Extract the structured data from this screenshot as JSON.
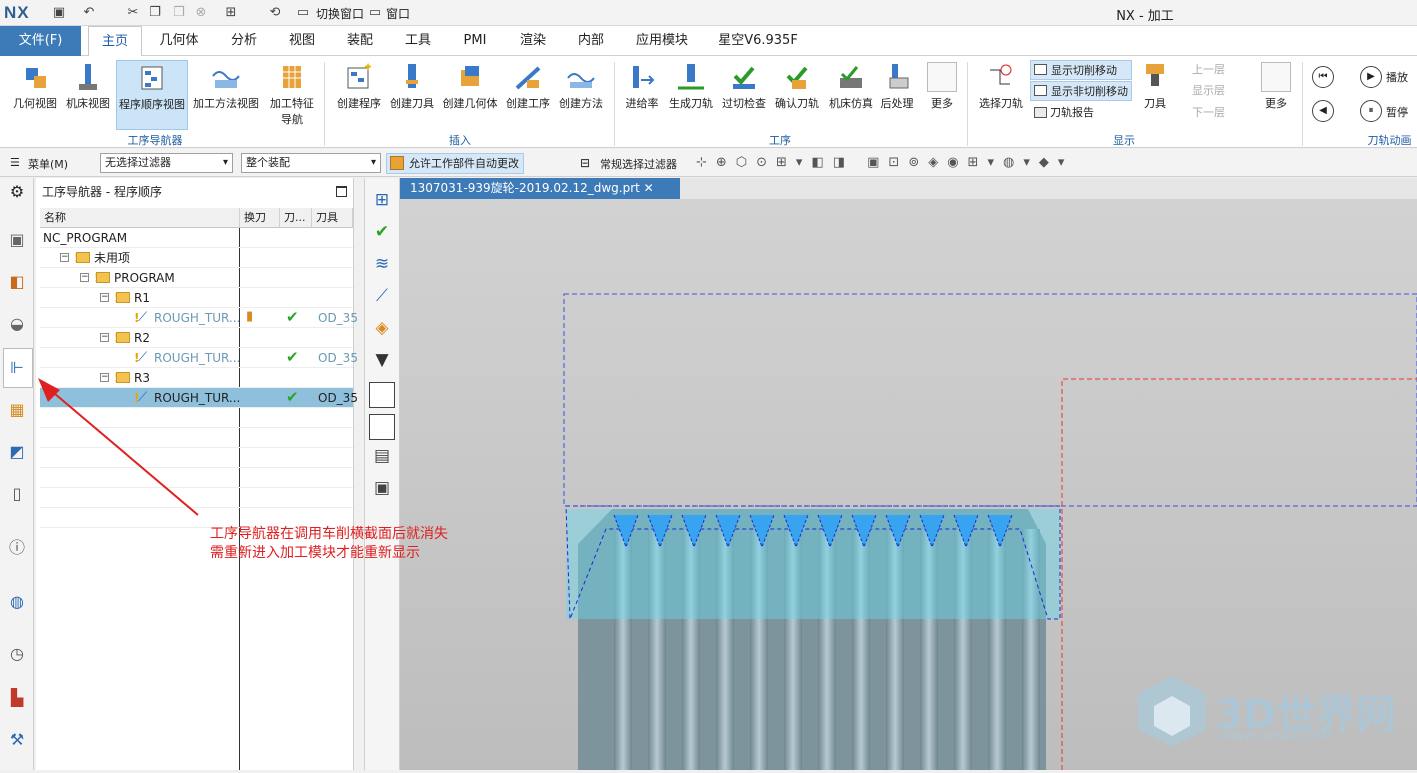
{
  "titlebar": {
    "logo": "NX",
    "switch_window": "切换窗口",
    "window": "窗口",
    "app_title": "NX - 加工"
  },
  "menu": {
    "file": "文件(F)",
    "tabs": [
      "主页",
      "几何体",
      "分析",
      "视图",
      "装配",
      "工具",
      "PMI",
      "渲染",
      "内部",
      "应用模块",
      "星空V6.935F"
    ]
  },
  "ribbon": {
    "nav_group": {
      "buttons": [
        "几何视图",
        "机床视图",
        "程序顺序视图",
        "加工方法视图",
        "加工特征导航"
      ],
      "label": "工序导航器"
    },
    "insert_group": {
      "buttons": [
        "创建程序",
        "创建刀具",
        "创建几何体",
        "创建工序",
        "创建方法"
      ],
      "label": "插入"
    },
    "operation_group": {
      "buttons": [
        "进给率",
        "生成刀轨",
        "过切检查",
        "确认刀轨",
        "机床仿真",
        "后处理",
        "更多"
      ],
      "label": "工序"
    },
    "display_group": {
      "select_tool": "选择刀轨",
      "show_cut": "显示切削移动",
      "show_noncut": "显示非切削移动",
      "toolpath_report": "刀轨报告",
      "tool": "刀具",
      "up": "上一层",
      "display": "显示层",
      "down": "下一层",
      "more": "更多",
      "label": "显示"
    },
    "anim_group": {
      "play": "播放",
      "pause": "暂停",
      "label": "刀轨动画"
    }
  },
  "toolbar2": {
    "menu": "菜单(M)",
    "filter": "无选择过滤器",
    "assembly": "整个装配",
    "allow": "允许工作部件自动更改",
    "general_filter": "常规选择过滤器"
  },
  "navigator": {
    "title": "工序导航器 - 程序顺序",
    "columns": [
      "名称",
      "换刀",
      "刀...",
      "刀具"
    ],
    "rows": [
      {
        "name": "NC_PROGRAM",
        "tool": "",
        "path": ""
      },
      {
        "name": "未用项",
        "tool": "",
        "path": ""
      },
      {
        "name": "PROGRAM",
        "tool": "",
        "path": ""
      },
      {
        "name": "R1",
        "tool": "",
        "path": ""
      },
      {
        "name": "ROUGH_TUR...",
        "tool": "OD_35",
        "path": "✔"
      },
      {
        "name": "R2",
        "tool": "",
        "path": ""
      },
      {
        "name": "ROUGH_TUR...",
        "tool": "OD_35",
        "path": "✔"
      },
      {
        "name": "R3",
        "tool": "",
        "path": ""
      },
      {
        "name": "ROUGH_TUR...",
        "tool": "OD_35",
        "path": "✔"
      }
    ]
  },
  "document_tab": "1307031-939旋轮-2019.02.12_dwg.prt",
  "annotation": {
    "line1": "工序导航器在调用车削横截面后就消失",
    "line2": "需重新进入加工模块才能重新显示"
  },
  "watermark": {
    "text": "3D世界网",
    "url": "WWW.3DSJW.COM"
  }
}
